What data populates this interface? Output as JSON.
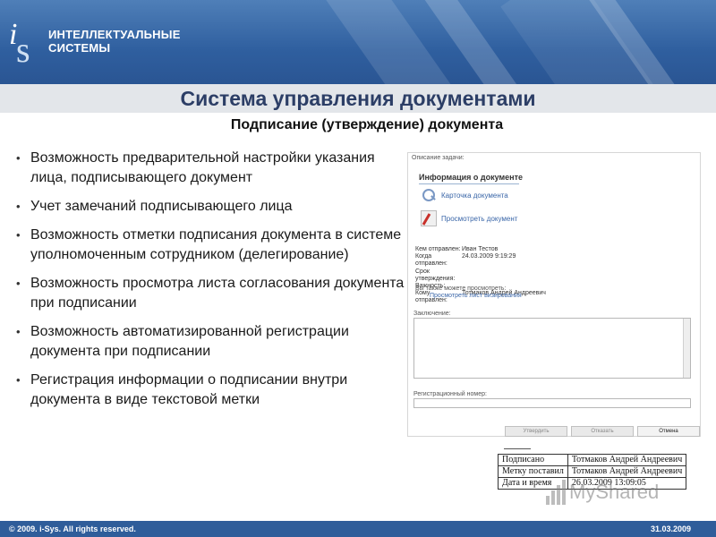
{
  "header": {
    "logo_mark_i": "i",
    "logo_mark_s": "s",
    "logo_line1": "ИНТЕЛЛЕКТУАЛЬНЫЕ",
    "logo_line2": "СИСТЕМЫ"
  },
  "title": "Система управления документами",
  "subtitle": "Подписание (утверждение) документа",
  "bullets": [
    "Возможность предварительной настройки указания лица, подписывающего документ",
    "Учет замечаний подписывающего лица",
    "Возможность отметки подписания документа в системе уполномоченным сотрудником (делегирование)",
    "Возможность просмотра листа согласования документа при подписании",
    "Возможность автоматизированной регистрации документа при подписании",
    "Регистрация информации о подписании внутри документа в виде текстовой метки"
  ],
  "bullet_char": "•",
  "panel": {
    "caption": "Описание задачи:",
    "info_title": "Информация о документе",
    "link_card": "Карточка документа",
    "link_view": "Просмотреть документ",
    "meta": [
      {
        "k": "Кем отправлен:",
        "v": "Иван Тестов"
      },
      {
        "k": "Когда отправлен:",
        "v": "24.03.2009 9:19:29"
      },
      {
        "k": "Срок утверждения:",
        "v": ""
      },
      {
        "k": "Важность:",
        "v": ""
      },
      {
        "k": "Кому отправлен:",
        "v": "Тотмаков Андрей Андреевич"
      }
    ],
    "also_text": "Вы также можете просмотреть:",
    "also_link": "Просмотреть лист визирования",
    "conclusion_label": "Заключение:",
    "reg_label": "Регистрационный номер:",
    "btn_approve": "Утвердить",
    "btn_reject": "Отказать",
    "btn_cancel": "Отмена"
  },
  "stamp": [
    [
      "Подписано",
      "Тотмаков Андрей Андреевич"
    ],
    [
      "Метку поставил",
      "Тотмаков Андрей Андреевич"
    ],
    [
      "Дата и время",
      "26.03.2009 13:09:05"
    ]
  ],
  "watermark": "MyShared",
  "footer": {
    "copyright": "© 2009. i-Sys. All rights reserved.",
    "date": "31.03.2009"
  }
}
